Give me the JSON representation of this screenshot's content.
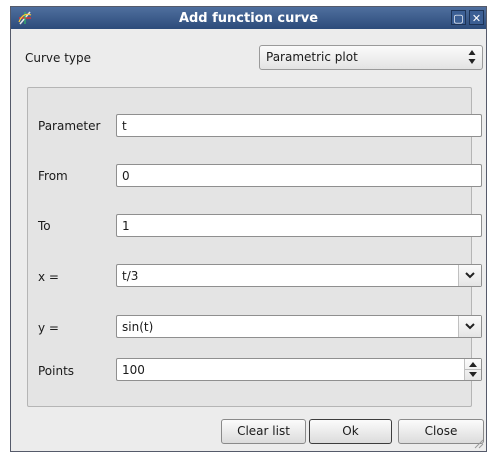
{
  "window": {
    "title": "Add function curve",
    "maximize_symbol": "▢",
    "close_symbol": "✕",
    "app_icon": "scidavis-icon"
  },
  "curve_type": {
    "label": "Curve type",
    "value": "Parametric plot"
  },
  "form": {
    "parameter": {
      "label": "Parameter",
      "value": "t"
    },
    "from": {
      "label": "From",
      "value": "0"
    },
    "to": {
      "label": "To",
      "value": "1"
    },
    "x": {
      "label": "x =",
      "value": "t/3"
    },
    "y": {
      "label": "y =",
      "value": "sin(t)"
    },
    "points": {
      "label": "Points",
      "value": "100"
    }
  },
  "buttons": {
    "clear": "Clear list",
    "ok": "Ok",
    "close": "Close"
  },
  "colors": {
    "titlebar_top": "#4f6f9e",
    "titlebar_bottom": "#2c4b7a",
    "window_bg": "#ececec"
  }
}
